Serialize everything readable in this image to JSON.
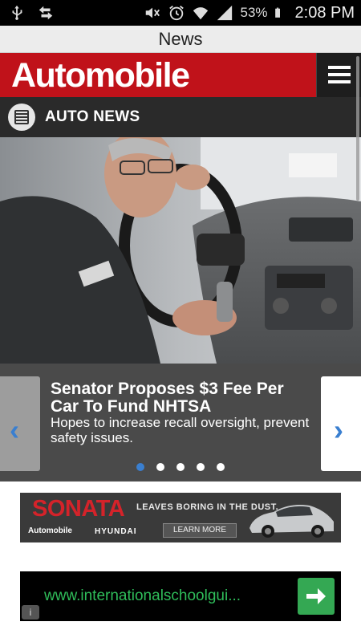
{
  "status_bar": {
    "battery_percent": "53%",
    "time": "2:08 PM",
    "icons": [
      "usb-icon",
      "sync-icon",
      "mute-icon",
      "alarm-icon",
      "wifi-icon",
      "signal-icon",
      "battery-icon"
    ]
  },
  "title_bar": {
    "title": "News"
  },
  "brand": {
    "name": "Automobile",
    "colors": {
      "brand_red": "#c0121a",
      "dark": "#222222"
    }
  },
  "section": {
    "label": "AUTO NEWS",
    "icon": "list-icon"
  },
  "carousel": {
    "headline": "Senator Proposes $3 Fee Per Car To Fund NHTSA",
    "subheadline": "Hopes to increase recall oversight, prevent safety issues.",
    "dots_total": 5,
    "active_dot": 1,
    "accent_color": "#3a7fd0"
  },
  "ads": {
    "sonata": {
      "title": "SONATA",
      "tagline": "LEAVES BORING IN THE DUST.",
      "brand_left": "Automobile",
      "brand_right": "HYUNDAI",
      "cta": "LEARN MORE"
    },
    "text_ad": {
      "url": "www.internationalschoolgui..."
    }
  }
}
